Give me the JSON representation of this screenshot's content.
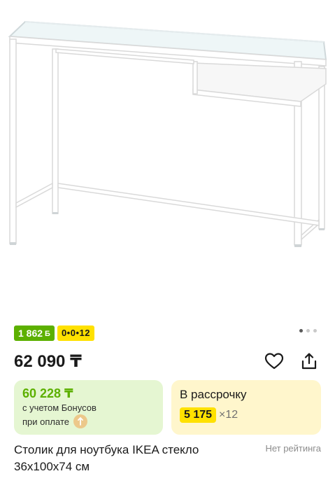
{
  "product": {
    "image_alt": "Столик для ноутбука IKEA стекло",
    "badges": {
      "bonus_value": "1 862",
      "bonus_icon": "Б",
      "installment": "0•0•12"
    },
    "gallery": {
      "count": 3,
      "active_index": 0
    },
    "price": "62 090 ₸",
    "actions": {
      "favorite_icon": "heart-icon",
      "share_icon": "share-icon"
    },
    "bonus_card": {
      "price": "60 228 ₸",
      "line1": "с учетом Бонусов",
      "line2": "при оплате"
    },
    "installment_card": {
      "title": "В рассрочку",
      "amount": "5 175",
      "multiplier": "×12"
    },
    "title": "Столик для ноутбука IKEA стекло 36х100х74 см",
    "rating_text": "Нет рейтинга"
  },
  "colors": {
    "green": "#5cb000",
    "yellow": "#ffe100",
    "bonus_card_bg": "#e5f6d2",
    "installment_card_bg": "#fff6cc"
  }
}
